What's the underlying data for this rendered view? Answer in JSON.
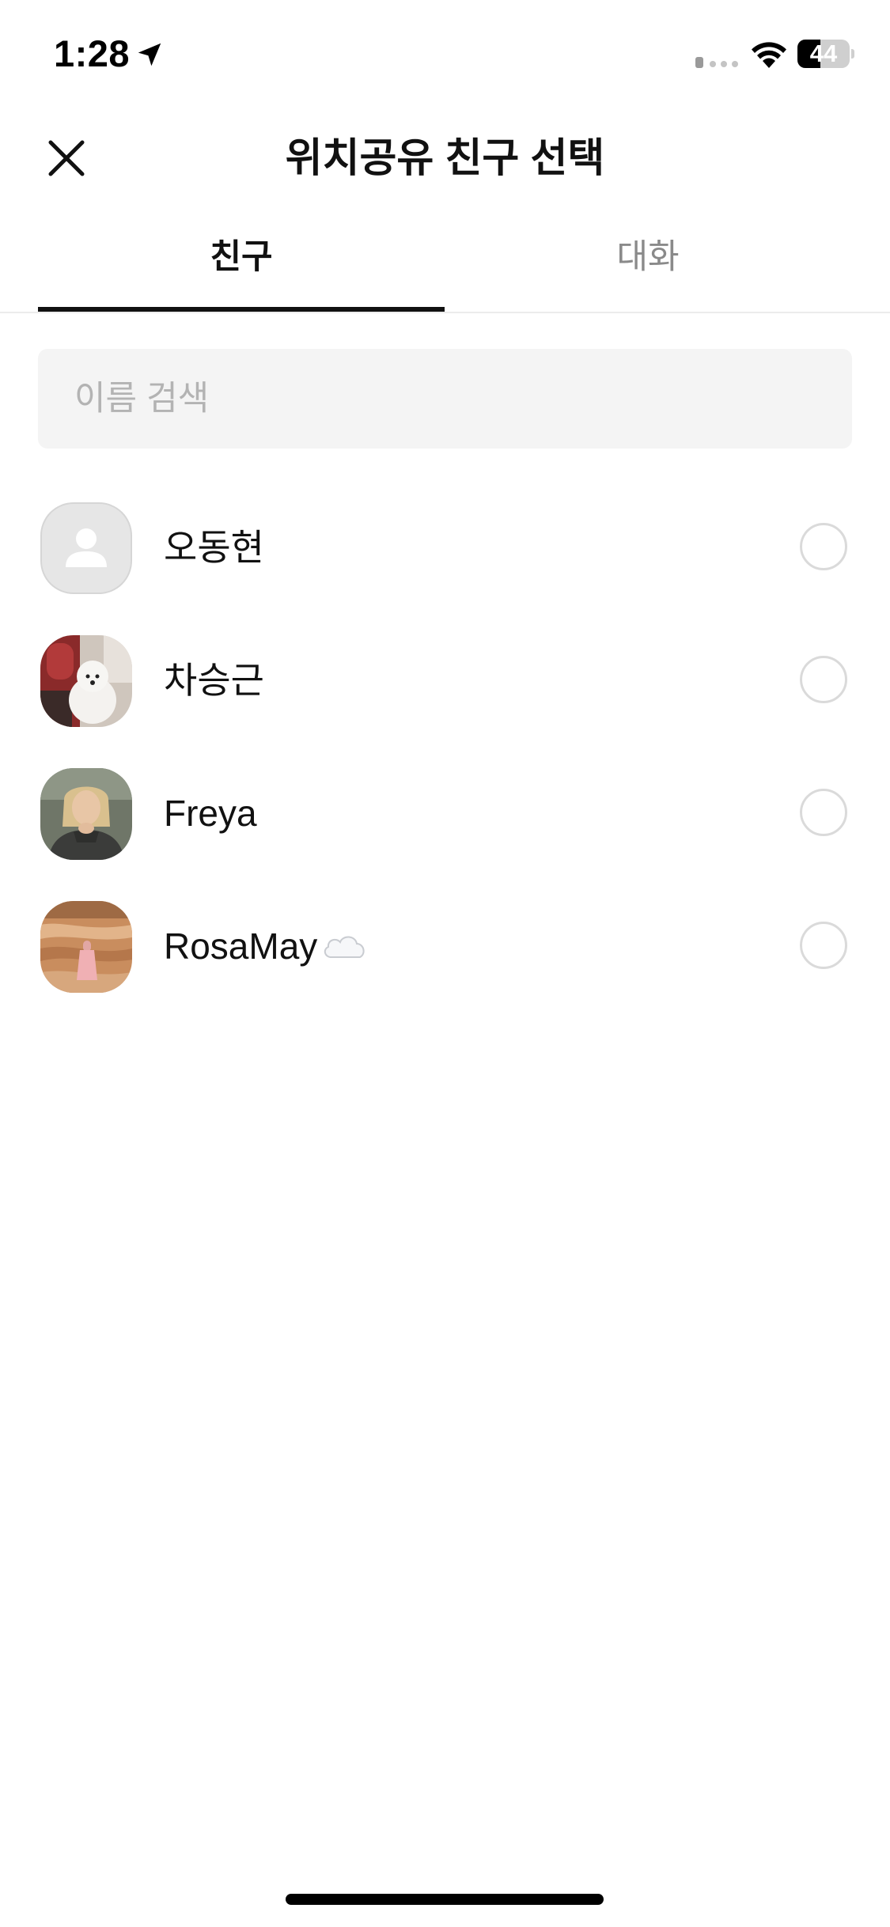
{
  "status_bar": {
    "time": "1:28",
    "battery_level": "44",
    "battery_fraction": 0.44,
    "icons": [
      "location-arrow-icon",
      "signal-dots-icon",
      "wifi-icon",
      "battery-icon"
    ]
  },
  "header": {
    "title": "위치공유 친구 선택",
    "close_icon": "close-icon"
  },
  "tabs": [
    {
      "label": "친구",
      "active": true
    },
    {
      "label": "대화",
      "active": false
    }
  ],
  "search": {
    "placeholder": "이름 검색",
    "value": ""
  },
  "friends": [
    {
      "name": "오동현",
      "emoji": "",
      "avatar": "default-profile",
      "selected": false
    },
    {
      "name": "차승근",
      "emoji": "",
      "avatar": "photo-white-dog",
      "selected": false
    },
    {
      "name": "Freya",
      "emoji": "",
      "avatar": "photo-person",
      "selected": false
    },
    {
      "name": "RosaMay",
      "emoji": "☁️",
      "avatar": "photo-canyon",
      "selected": false
    }
  ],
  "colors": {
    "text_primary": "#111111",
    "text_inactive": "#8a8a8a",
    "placeholder": "#b3b3b3",
    "search_bg": "#f4f4f4",
    "radio_border": "#dadada",
    "default_avatar_bg": "#e6e6e6"
  }
}
